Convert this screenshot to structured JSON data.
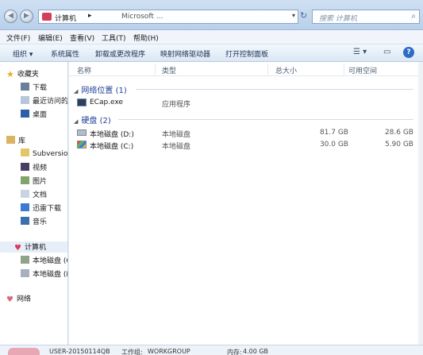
{
  "address": {
    "crumb": "计算机",
    "crumb_sep": "▸",
    "blurred_text": "Microsoft ...",
    "search_placeholder": "搜索 计算机"
  },
  "menu": [
    "文件(F)",
    "编辑(E)",
    "查看(V)",
    "工具(T)",
    "帮助(H)"
  ],
  "toolbar": {
    "organize": "组织 ▾",
    "system_props": "系统属性",
    "uninstall": "卸载或更改程序",
    "map_drive": "映射网络驱动器",
    "control_panel": "打开控制面板"
  },
  "nav": {
    "favorites": "收藏夹",
    "downloads": "下载",
    "recent": "最近访问的",
    "desktop": "桌面",
    "libraries": "库",
    "subversion": "Subversion",
    "videos": "视频",
    "pictures": "图片",
    "documents": "文档",
    "xunlei": "迅雷下载",
    "music": "音乐",
    "computer": "计算机",
    "drive_d": "本地磁盘 (C",
    "drive_c": "本地磁盘 (D",
    "network": "网络"
  },
  "columns": {
    "name": "名称",
    "type": "类型",
    "total": "总大小",
    "free": "可用空间"
  },
  "groups": {
    "network": "网络位置 (1)",
    "disks": "硬盘 (2)"
  },
  "network_items": [
    {
      "name": "ECap.exe",
      "type": "应用程序"
    }
  ],
  "disk_items": [
    {
      "name": "本地磁盘 (D:)",
      "type": "本地磁盘",
      "total": "81.7 GB",
      "free": "28.6 GB"
    },
    {
      "name": "本地磁盘 (C:)",
      "type": "本地磁盘",
      "total": "30.0 GB",
      "free": "5.90 GB"
    }
  ],
  "status": {
    "computer_name": "USER-20150114QB",
    "workgroup_label": "工作组:",
    "workgroup": "WORKGROUP",
    "memory_label": "内存:",
    "memory": "4.00 GB"
  },
  "colors": {
    "accent": "#1e3e9a",
    "header_bg": "#dfe9f5"
  }
}
